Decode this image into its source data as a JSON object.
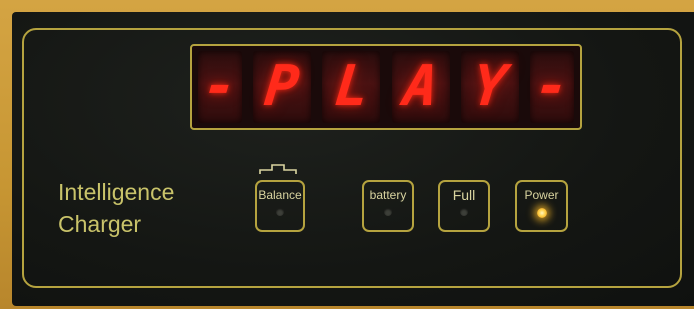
{
  "display": {
    "chars": [
      "-",
      "P",
      "L",
      "A",
      "Y",
      "-"
    ],
    "color": "#ff2a1a"
  },
  "brand": {
    "line1": "Intelligence",
    "line2": "Charger",
    "color": "#c9c36a"
  },
  "indicators": [
    {
      "label": "Balance",
      "led": "off"
    },
    {
      "label": "battery",
      "led": "off"
    },
    {
      "label": "Full",
      "led": "off"
    },
    {
      "label": "Power",
      "led": "on"
    }
  ],
  "colors": {
    "panel": "#141613",
    "outline": "#b5a33f",
    "background": "#c99a3a",
    "led_on": "#ffd24a"
  }
}
